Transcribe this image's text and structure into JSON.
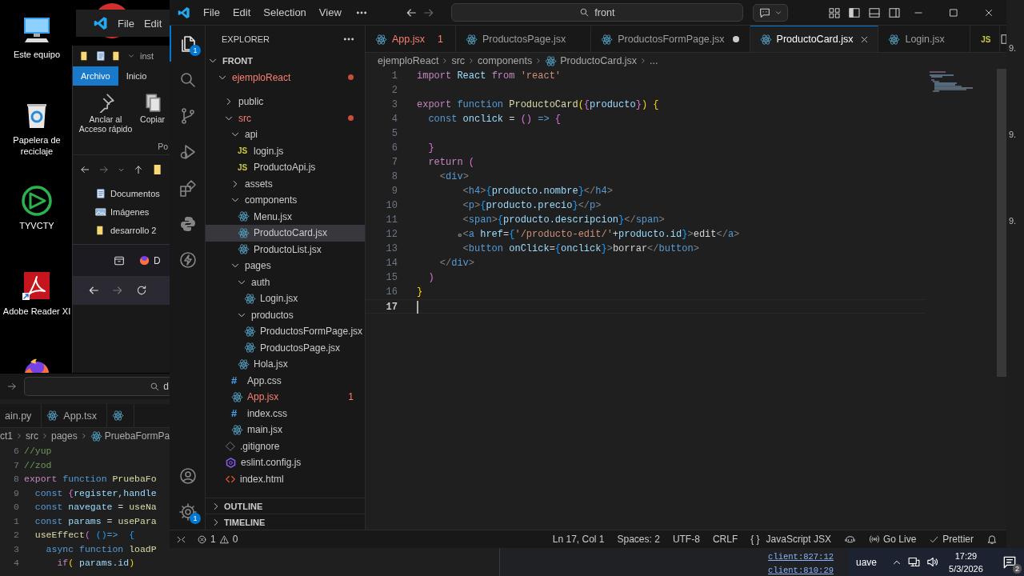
{
  "desktop": {
    "icons": [
      {
        "kind": "computer",
        "label": "Este equipo"
      },
      {
        "kind": "recycle",
        "label": "Papelera de reciclaje"
      },
      {
        "kind": "logic",
        "label": "TYVCTY"
      },
      {
        "kind": "pdf",
        "label": "Adobe Reader XI"
      },
      {
        "kind": "firefox"
      }
    ]
  },
  "back_vscode": {
    "menu": [
      "File",
      "Edit"
    ]
  },
  "file_explorer": {
    "address": "inst",
    "tabs": [
      {
        "label": "Archivo",
        "selected": true
      },
      {
        "label": "Inicio",
        "selected": false
      }
    ],
    "ribbon": [
      {
        "kind": "pin",
        "label": "Anclar al Acceso rápido"
      },
      {
        "kind": "copy",
        "label": "Copiar"
      }
    ],
    "group_label": "Po",
    "quick_access": [
      {
        "kind": "docs",
        "label": "Documentos"
      },
      {
        "kind": "images",
        "label": "Imágenes"
      },
      {
        "kind": "folder",
        "label": "desarrollo 2"
      }
    ],
    "browser_tab": "D"
  },
  "back_editor": {
    "search_text": "d",
    "tabs": [
      {
        "kind": "py",
        "label": "ain.py"
      },
      {
        "kind": "react",
        "label": "App.tsx"
      },
      {
        "kind": "react"
      }
    ],
    "breadcrumb": [
      {
        "kind": "text",
        "label": "ct1"
      },
      {
        "kind": "text",
        "label": "src"
      },
      {
        "kind": "text",
        "label": "pages"
      },
      {
        "kind": "react",
        "label": "PruebaFormPa"
      }
    ],
    "lines": [
      {
        "n": "6",
        "tokens": [
          {
            "text": "//yup",
            "kind": "comment"
          }
        ]
      },
      {
        "n": "7",
        "tokens": [
          {
            "text": "//zod",
            "kind": "comment"
          }
        ]
      },
      {
        "n": "8",
        "tokens": [
          {
            "text": "export",
            "kind": "kw"
          },
          {
            "text": " function ",
            "kind": "def"
          },
          {
            "text": "PruebaFo",
            "kind": "fn"
          }
        ]
      },
      {
        "n": "9",
        "tokens": [
          {
            "text": "  const ",
            "kind": "def"
          },
          {
            "text": "{",
            "kind": "br2"
          },
          {
            "text": "register,handle",
            "kind": "var"
          }
        ]
      },
      {
        "n": "0",
        "tokens": [
          {
            "text": "  const ",
            "kind": "def"
          },
          {
            "text": "navegate",
            "kind": "var"
          },
          {
            "text": " = ",
            "kind": "plain"
          },
          {
            "text": "useNa",
            "kind": "fn"
          }
        ]
      },
      {
        "n": "1",
        "tokens": [
          {
            "text": "  const ",
            "kind": "def"
          },
          {
            "text": "params",
            "kind": "var"
          },
          {
            "text": " = ",
            "kind": "plain"
          },
          {
            "text": "usePara",
            "kind": "fn"
          }
        ]
      },
      {
        "n": "2",
        "tokens": [
          {
            "text": "  useEffect",
            "kind": "fn"
          },
          {
            "text": "(",
            "kind": "br2"
          },
          {
            "text": " ()",
            "kind": "br3"
          },
          {
            "text": "=>",
            "kind": "def"
          },
          {
            "text": "  {",
            "kind": "br3"
          }
        ]
      },
      {
        "n": "3",
        "tokens": [
          {
            "text": "    async",
            "kind": "def"
          },
          {
            "text": " function ",
            "kind": "def"
          },
          {
            "text": "loadP",
            "kind": "fn"
          }
        ]
      },
      {
        "n": "4",
        "tokens": [
          {
            "text": "      if",
            "kind": "kw"
          },
          {
            "text": "(",
            "kind": "br1"
          },
          {
            "text": " params.id",
            "kind": "var"
          },
          {
            "text": ")",
            "kind": "br1"
          }
        ]
      }
    ]
  },
  "vscode": {
    "menu": [
      "File",
      "Edit",
      "Selection",
      "View"
    ],
    "search": "front",
    "activity": [
      {
        "kind": "files",
        "selected": true,
        "badge": "1"
      },
      {
        "kind": "search",
        "selected": false
      },
      {
        "kind": "branch",
        "selected": false
      },
      {
        "kind": "debug",
        "selected": false
      },
      {
        "kind": "extensions",
        "selected": false
      },
      {
        "kind": "python",
        "selected": false
      },
      {
        "kind": "bolt",
        "selected": false
      }
    ],
    "activity_bottom": [
      {
        "kind": "account"
      },
      {
        "kind": "gear",
        "badge": "1"
      }
    ],
    "sidebar": {
      "title": "EXPLORER",
      "section": "FRONT",
      "tree": [
        {
          "label": "ejemploReact",
          "kind": "folder",
          "expanded": true,
          "selected": false,
          "error": true,
          "children": [
            {
              "label": "public",
              "kind": "folder",
              "expanded": false,
              "selected": false,
              "error": false
            },
            {
              "label": "src",
              "kind": "folder",
              "expanded": true,
              "selected": false,
              "error": true,
              "children": [
                {
                  "label": "api",
                  "kind": "folder",
                  "expanded": true,
                  "selected": false,
                  "error": false,
                  "children": [
                    {
                      "label": "login.js",
                      "kind": "js",
                      "icon_text": "JS",
                      "selected": false,
                      "error": false
                    },
                    {
                      "label": "ProductoApi.js",
                      "kind": "js",
                      "icon_text": "JS",
                      "selected": false,
                      "error": false
                    }
                  ]
                },
                {
                  "label": "assets",
                  "kind": "folder",
                  "expanded": false,
                  "selected": false,
                  "error": false
                },
                {
                  "label": "components",
                  "kind": "folder",
                  "expanded": true,
                  "selected": false,
                  "error": false,
                  "children": [
                    {
                      "label": "Menu.jsx",
                      "kind": "react",
                      "selected": false,
                      "error": false
                    },
                    {
                      "label": "ProductoCard.jsx",
                      "kind": "react",
                      "selected": true,
                      "error": false
                    },
                    {
                      "label": "ProductoList.jsx",
                      "kind": "react",
                      "selected": false,
                      "error": false
                    }
                  ]
                },
                {
                  "label": "pages",
                  "kind": "folder",
                  "expanded": true,
                  "selected": false,
                  "error": false,
                  "children": [
                    {
                      "label": "auth",
                      "kind": "folder",
                      "expanded": true,
                      "selected": false,
                      "error": false,
                      "children": [
                        {
                          "label": "Login.jsx",
                          "kind": "react",
                          "selected": false,
                          "error": false
                        }
                      ]
                    },
                    {
                      "label": "productos",
                      "kind": "folder",
                      "expanded": true,
                      "selected": false,
                      "error": false,
                      "children": [
                        {
                          "label": "ProductosFormPage.jsx",
                          "kind": "react",
                          "selected": false,
                          "error": false
                        },
                        {
                          "label": "ProductosPage.jsx",
                          "kind": "react",
                          "selected": false,
                          "error": false
                        }
                      ]
                    },
                    {
                      "label": "Hola.jsx",
                      "kind": "react",
                      "selected": false,
                      "error": false
                    }
                  ]
                },
                {
                  "label": "App.css",
                  "kind": "css",
                  "icon_text": "#",
                  "selected": false,
                  "error": false
                },
                {
                  "label": "App.jsx",
                  "kind": "react",
                  "selected": false,
                  "error": true,
                  "badge": "1"
                },
                {
                  "label": "index.css",
                  "kind": "css",
                  "icon_text": "#",
                  "selected": false,
                  "error": false
                },
                {
                  "label": "main.jsx",
                  "kind": "react",
                  "selected": false,
                  "error": false
                }
              ]
            },
            {
              "label": ".gitignore",
              "kind": "git",
              "selected": false,
              "error": false
            },
            {
              "label": "eslint.config.js",
              "kind": "eslint",
              "selected": false,
              "error": false
            },
            {
              "label": "index.html",
              "kind": "html",
              "selected": false,
              "error": false
            }
          ]
        }
      ],
      "panels": [
        "OUTLINE",
        "TIMELINE"
      ]
    },
    "tabs": [
      {
        "label": "App.jsx",
        "kind": "react",
        "selected": false,
        "dirty": false,
        "error": true,
        "badge": "1"
      },
      {
        "label": "ProductosPage.jsx",
        "kind": "react",
        "selected": false,
        "dirty": false,
        "error": false
      },
      {
        "label": "ProductosFormPage.jsx",
        "kind": "react",
        "selected": false,
        "dirty": true,
        "error": false
      },
      {
        "label": "ProductoCard.jsx",
        "kind": "react",
        "selected": true,
        "dirty": false,
        "error": false
      },
      {
        "label": "Login.jsx",
        "kind": "react",
        "selected": false,
        "dirty": false,
        "error": false
      },
      {
        "kind": "js",
        "icon_text": "JS",
        "selected": false
      }
    ],
    "breadcrumb": [
      {
        "kind": "text",
        "label": "ejemploReact"
      },
      {
        "kind": "text",
        "label": "src"
      },
      {
        "kind": "text",
        "label": "components"
      },
      {
        "kind": "react",
        "label": "ProductoCard.jsx"
      },
      {
        "kind": "text",
        "label": "..."
      }
    ],
    "editor": {
      "lines": [
        {
          "n": "1",
          "current": false,
          "tokens": [
            {
              "text": "import",
              "kind": "kw"
            },
            {
              "text": " React ",
              "kind": "var"
            },
            {
              "text": "from",
              "kind": "kw"
            },
            {
              "text": " 'react'",
              "kind": "str"
            }
          ]
        },
        {
          "n": "2",
          "current": false
        },
        {
          "n": "3",
          "current": false,
          "tokens": [
            {
              "text": "export",
              "kind": "kw"
            },
            {
              "text": " function ",
              "kind": "def"
            },
            {
              "text": "ProductoCard",
              "kind": "fn"
            },
            {
              "text": "(",
              "kind": "br1"
            },
            {
              "text": "{",
              "kind": "br2"
            },
            {
              "text": "producto",
              "kind": "var"
            },
            {
              "text": "}",
              "kind": "br2"
            },
            {
              "text": ")",
              "kind": "br1"
            },
            {
              "text": " {",
              "kind": "br1"
            }
          ]
        },
        {
          "n": "4",
          "current": false,
          "tokens": [
            {
              "text": "  const",
              "kind": "def"
            },
            {
              "text": " onclick ",
              "kind": "var"
            },
            {
              "text": "= ",
              "kind": "plain"
            },
            {
              "text": "()",
              "kind": "br2"
            },
            {
              "text": " => ",
              "kind": "def"
            },
            {
              "text": "{",
              "kind": "br2"
            }
          ]
        },
        {
          "n": "5",
          "current": false
        },
        {
          "n": "6",
          "current": false,
          "tokens": [
            {
              "text": "  }",
              "kind": "br2"
            }
          ]
        },
        {
          "n": "7",
          "current": false,
          "tokens": [
            {
              "text": "  return",
              "kind": "kw"
            },
            {
              "text": " (",
              "kind": "br2"
            }
          ]
        },
        {
          "n": "8",
          "current": false,
          "tokens": [
            {
              "text": "    <",
              "kind": "ang"
            },
            {
              "text": "div",
              "kind": "tag"
            },
            {
              "text": ">",
              "kind": "ang"
            }
          ]
        },
        {
          "n": "9",
          "current": false,
          "tokens": [
            {
              "text": "        <",
              "kind": "ang"
            },
            {
              "text": "h4",
              "kind": "tag"
            },
            {
              "text": ">",
              "kind": "ang"
            },
            {
              "text": "{",
              "kind": "br3"
            },
            {
              "text": "producto.nombre",
              "kind": "var"
            },
            {
              "text": "}",
              "kind": "br3"
            },
            {
              "text": "</",
              "kind": "ang"
            },
            {
              "text": "h4",
              "kind": "tag"
            },
            {
              "text": ">",
              "kind": "ang"
            }
          ]
        },
        {
          "n": "10",
          "current": false,
          "tokens": [
            {
              "text": "        <",
              "kind": "ang"
            },
            {
              "text": "p",
              "kind": "tag"
            },
            {
              "text": ">",
              "kind": "ang"
            },
            {
              "text": "{",
              "kind": "br3"
            },
            {
              "text": "producto.precio",
              "kind": "var"
            },
            {
              "text": "}",
              "kind": "br3"
            },
            {
              "text": "</",
              "kind": "ang"
            },
            {
              "text": "p",
              "kind": "tag"
            },
            {
              "text": ">",
              "kind": "ang"
            }
          ]
        },
        {
          "n": "11",
          "current": false,
          "tokens": [
            {
              "text": "        <",
              "kind": "ang"
            },
            {
              "text": "span",
              "kind": "tag"
            },
            {
              "text": ">",
              "kind": "ang"
            },
            {
              "text": "{",
              "kind": "br3"
            },
            {
              "text": "producto.descripcion",
              "kind": "var"
            },
            {
              "text": "}",
              "kind": "br3"
            },
            {
              "text": "</",
              "kind": "ang"
            },
            {
              "text": "span",
              "kind": "tag"
            },
            {
              "text": ">",
              "kind": "ang"
            }
          ]
        },
        {
          "n": "12",
          "current": false,
          "marker": true,
          "tokens": [
            {
              "text": "        <",
              "kind": "ang"
            },
            {
              "text": "a",
              "kind": "tag"
            },
            {
              "text": " href",
              "kind": "var"
            },
            {
              "text": "=",
              "kind": "plain"
            },
            {
              "text": "{",
              "kind": "br3"
            },
            {
              "text": "'/producto-edit/'",
              "kind": "str"
            },
            {
              "text": "+",
              "kind": "plain"
            },
            {
              "text": "producto.id",
              "kind": "var"
            },
            {
              "text": "}",
              "kind": "br3"
            },
            {
              "text": ">",
              "kind": "ang"
            },
            {
              "text": "edit",
              "kind": "plain"
            },
            {
              "text": "</",
              "kind": "ang"
            },
            {
              "text": "a",
              "kind": "tag"
            },
            {
              "text": ">",
              "kind": "ang"
            }
          ]
        },
        {
          "n": "13",
          "current": false,
          "tokens": [
            {
              "text": "        <",
              "kind": "ang"
            },
            {
              "text": "button",
              "kind": "tag"
            },
            {
              "text": " onClick",
              "kind": "var"
            },
            {
              "text": "=",
              "kind": "plain"
            },
            {
              "text": "{",
              "kind": "br3"
            },
            {
              "text": "onclick",
              "kind": "var"
            },
            {
              "text": "}",
              "kind": "br3"
            },
            {
              "text": ">",
              "kind": "ang"
            },
            {
              "text": "borrar",
              "kind": "plain"
            },
            {
              "text": "</",
              "kind": "ang"
            },
            {
              "text": "button",
              "kind": "tag"
            },
            {
              "text": ">",
              "kind": "ang"
            }
          ]
        },
        {
          "n": "14",
          "current": false,
          "tokens": [
            {
              "text": "    </",
              "kind": "ang"
            },
            {
              "text": "div",
              "kind": "tag"
            },
            {
              "text": ">",
              "kind": "ang"
            }
          ]
        },
        {
          "n": "15",
          "current": false,
          "tokens": [
            {
              "text": "  )",
              "kind": "br2"
            }
          ]
        },
        {
          "n": "16",
          "current": false,
          "tokens": [
            {
              "text": "}",
              "kind": "br1"
            }
          ]
        },
        {
          "n": "17",
          "current": true
        }
      ]
    },
    "status": {
      "errors": "1",
      "warnings": "0",
      "items": [
        {
          "kind": "text",
          "label": "Ln 17, Col 1"
        },
        {
          "kind": "text",
          "label": "Spaces: 2"
        },
        {
          "kind": "text",
          "label": "UTF-8"
        },
        {
          "kind": "text",
          "label": "CRLF"
        },
        {
          "kind": "language",
          "icon_text": "{ }",
          "label": "JavaScript JSX"
        },
        {
          "kind": "copilot"
        },
        {
          "kind": "live",
          "label": "Go Live"
        },
        {
          "kind": "check",
          "label": "Prettier"
        },
        {
          "kind": "bell"
        }
      ]
    }
  },
  "console": {
    "links": [
      "client:827:12",
      "client:810:29"
    ]
  },
  "tray": {
    "partial_text": "uave",
    "time": "17:29",
    "date": "5/3/2026",
    "notifications": "2"
  },
  "edge_fragments": [
    "9.",
    "9.",
    "9."
  ]
}
